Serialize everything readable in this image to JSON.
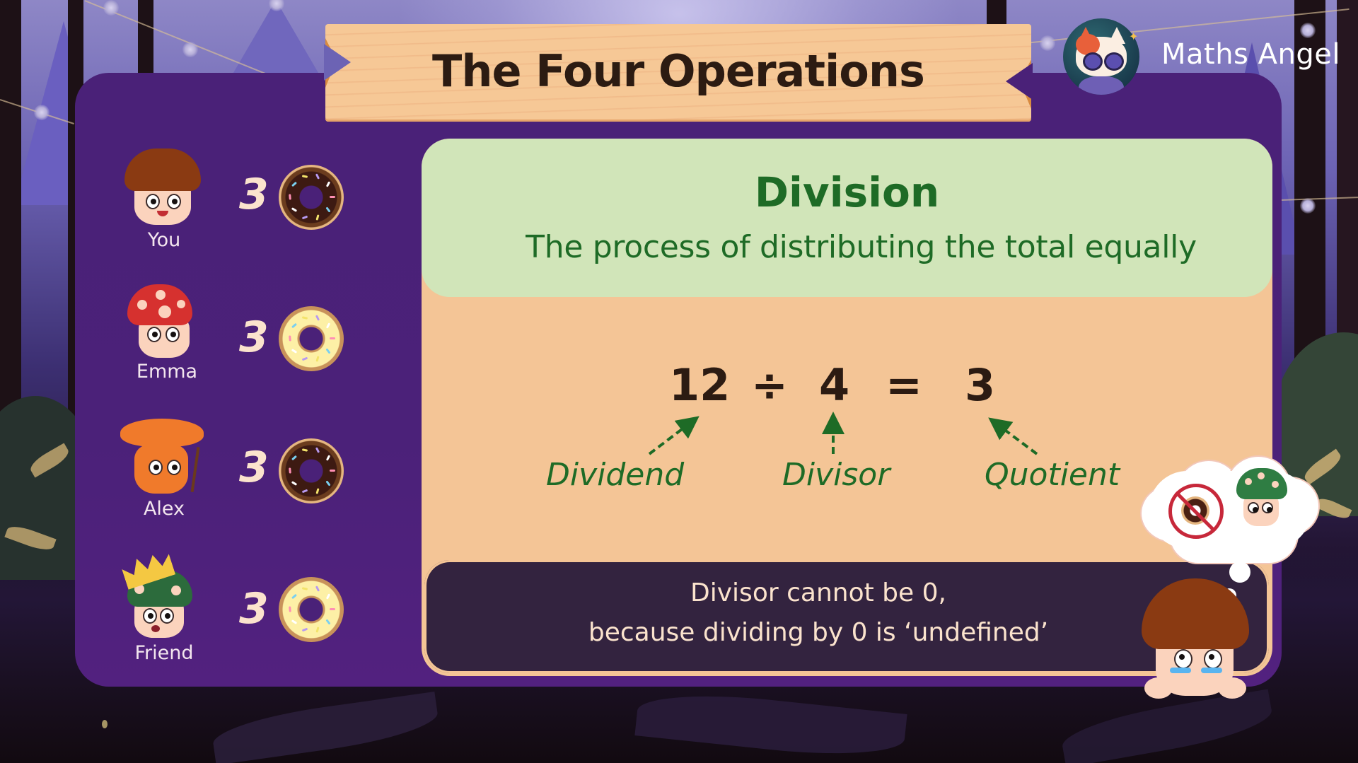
{
  "header": {
    "title": "The Four Operations",
    "brand_name": "Maths Angel",
    "logo_icon": "cat-with-sunglasses-logo"
  },
  "sharing": {
    "people": [
      {
        "name": "You",
        "count": "3",
        "donut": "chocolate"
      },
      {
        "name": "Emma",
        "count": "3",
        "donut": "vanilla"
      },
      {
        "name": "Alex",
        "count": "3",
        "donut": "chocolate"
      },
      {
        "name": "Friend",
        "count": "3",
        "donut": "vanilla"
      }
    ]
  },
  "definition": {
    "title": "Division",
    "text": "The process of distributing the total equally"
  },
  "equation": {
    "dividend": "12",
    "operator": "÷",
    "divisor": "4",
    "equals": "=",
    "quotient": "3",
    "labels": {
      "dividend": "Dividend",
      "divisor": "Divisor",
      "quotient": "Quotient"
    }
  },
  "note": {
    "line1": "Divisor cannot be 0,",
    "line2": "because dividing by 0 is ‘undefined’"
  },
  "thought_bubble": {
    "icons": [
      "no-donut-icon",
      "sad-green-mushroom"
    ]
  },
  "colors": {
    "panel": "#4a2178",
    "definition_bg": "#d1e5b9",
    "definition_text": "#1e6b26",
    "card_bg": "#f4c596",
    "note_bg": "#33233f",
    "note_text": "#fbe3cd",
    "title_text": "#2c1b12"
  }
}
